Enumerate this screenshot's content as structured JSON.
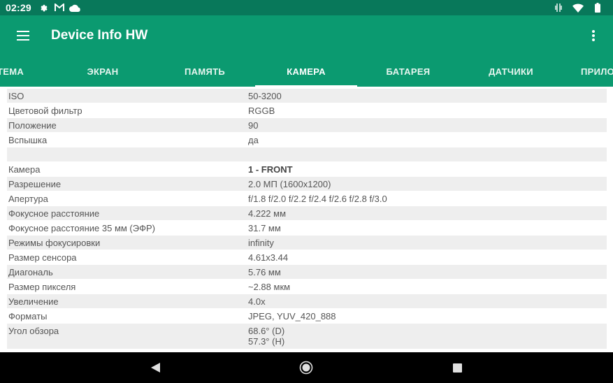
{
  "status_bar": {
    "time": "02:29",
    "icons_left": [
      "gear-icon",
      "gmail-icon",
      "cloud-icon"
    ],
    "icons_right": [
      "vibrate-icon",
      "wifi-icon",
      "battery-icon"
    ]
  },
  "app_bar": {
    "title": "Device Info HW",
    "menu_icon": "hamburger-menu-icon",
    "overflow_icon": "more-vert-icon"
  },
  "tabs": [
    {
      "label": "ТЕМА"
    },
    {
      "label": "ЭКРАН"
    },
    {
      "label": "ПАМЯТЬ"
    },
    {
      "label": "КАМЕРА",
      "active": true
    },
    {
      "label": "БАТАРЕЯ"
    },
    {
      "label": "ДАТЧИКИ"
    },
    {
      "label": "ПРИЛО"
    }
  ],
  "rows": [
    {
      "label": "ISO",
      "value": "50-3200"
    },
    {
      "label": "Цветовой фильтр",
      "value": "RGGB"
    },
    {
      "label": "Положение",
      "value": "90"
    },
    {
      "label": "Вспышка",
      "value": "да"
    },
    {
      "label": "",
      "value": ""
    },
    {
      "label": "Камера",
      "value": "1 - FRONT"
    },
    {
      "label": "Разрешение",
      "value": "2.0 МП (1600x1200)"
    },
    {
      "label": "Апертура",
      "value": "f/1.8 f/2.0 f/2.2 f/2.4 f/2.6 f/2.8 f/3.0"
    },
    {
      "label": "Фокусное расстояние",
      "value": "4.222 мм"
    },
    {
      "label": "Фокусное расстояние 35 мм (ЭФР)",
      "value": "31.7 мм"
    },
    {
      "label": "Режимы фокусировки",
      "value": "infinity"
    },
    {
      "label": "Размер сенсора",
      "value": "4.61x3.44"
    },
    {
      "label": "Диагональ",
      "value": "5.76 мм"
    },
    {
      "label": "Размер пикселя",
      "value": "~2.88 мкм"
    },
    {
      "label": "Увеличение",
      "value": "4.0x"
    },
    {
      "label": "Форматы",
      "value": "JPEG, YUV_420_888"
    },
    {
      "label": "Угол обзора",
      "value_line1": "68.6° (D)",
      "value_line2": "57.3° (H)"
    }
  ],
  "nav_bar": {
    "back_icon": "back-triangle-icon",
    "home_icon": "home-circle-icon",
    "recents_icon": "recents-square-icon"
  },
  "colors": {
    "status_bar": "#08785a",
    "app_bar": "#0b9a70",
    "row_stripe": "#eeeeee",
    "text": "#555555"
  }
}
